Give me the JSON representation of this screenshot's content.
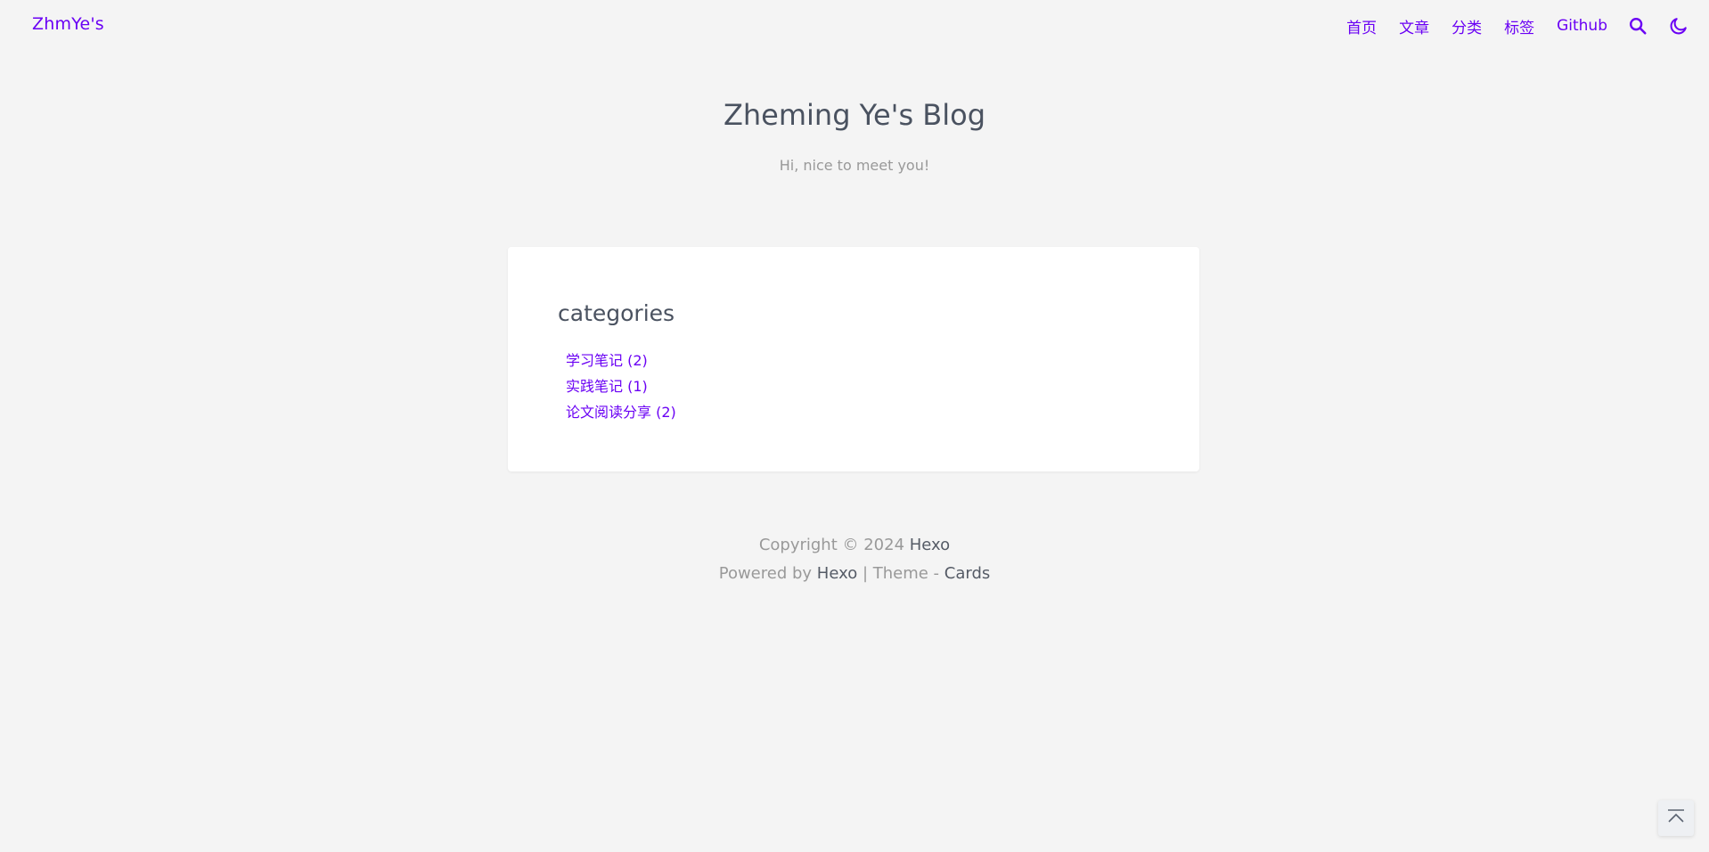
{
  "nav": {
    "brand": "ZhmYe's",
    "links": [
      "首页",
      "文章",
      "分类",
      "标签",
      "Github"
    ],
    "icons": [
      "search-icon",
      "moon-icon"
    ],
    "accent_color": "#6a00f4"
  },
  "header": {
    "title": "Zheming Ye's Blog",
    "subtitle": "Hi, nice to meet you!"
  },
  "card": {
    "title": "categories",
    "items": [
      "学习笔记 (2)",
      "实践笔记 (1)",
      "论文阅读分享 (2)"
    ]
  },
  "footer": {
    "copyright_prefix": "Copyright © 2024",
    "copyright_link": "Hexo",
    "powered_prefix": "Powered by",
    "powered_link": "Hexo",
    "theme_sep": "| Theme -",
    "theme_link": "Cards"
  },
  "back_to_top_icon": "arrow-up-to-top-icon"
}
